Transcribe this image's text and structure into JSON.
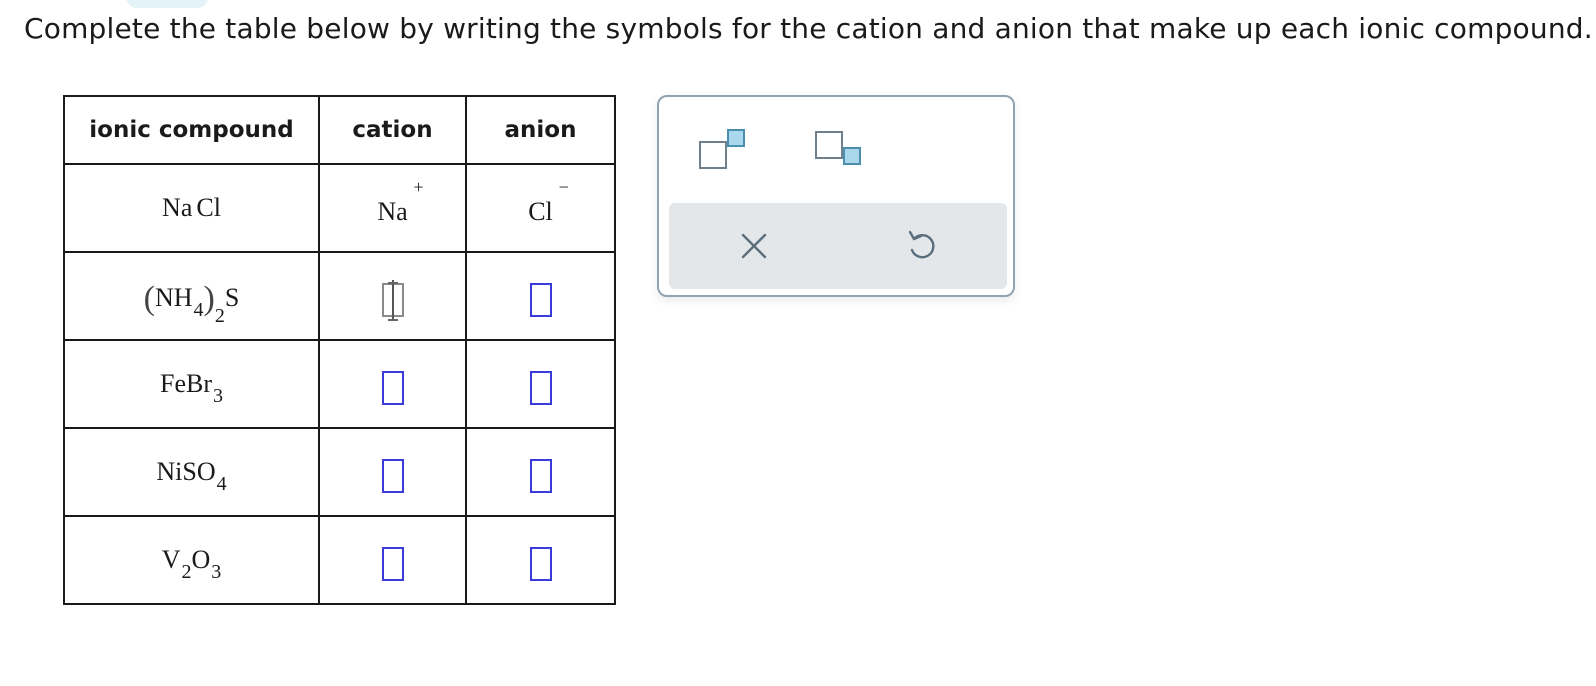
{
  "instructions": "Complete the table below by writing the symbols for the cation and anion that make up each ionic compound. T",
  "table": {
    "headers": [
      "ionic compound",
      "cation",
      "anion"
    ],
    "rows": [
      {
        "compound": {
          "parts": [
            {
              "t": "Na"
            },
            {
              "gap": true
            },
            {
              "t": "Cl"
            }
          ]
        },
        "cation": {
          "given": true,
          "symbol": "Na",
          "charge": "+"
        },
        "anion": {
          "given": true,
          "symbol": "Cl",
          "charge": "−"
        }
      },
      {
        "compound": {
          "parts": [
            {
              "paren": "("
            },
            {
              "t": "N"
            },
            {
              "t": "H"
            },
            {
              "sub": "4"
            },
            {
              "paren": ")"
            },
            {
              "subout": "2"
            },
            {
              "t": "S"
            }
          ]
        },
        "cation": {
          "given": false,
          "active": true
        },
        "anion": {
          "given": false
        }
      },
      {
        "compound": {
          "parts": [
            {
              "t": "Fe"
            },
            {
              "t": "Br"
            },
            {
              "sub": "3"
            }
          ]
        },
        "cation": {
          "given": false
        },
        "anion": {
          "given": false
        }
      },
      {
        "compound": {
          "parts": [
            {
              "t": "Ni"
            },
            {
              "t": "S"
            },
            {
              "t": "O"
            },
            {
              "sub": "4"
            }
          ]
        },
        "cation": {
          "given": false
        },
        "anion": {
          "given": false
        }
      },
      {
        "compound": {
          "parts": [
            {
              "t": "V"
            },
            {
              "sub": "2"
            },
            {
              "t": "O"
            },
            {
              "sub": "3"
            }
          ]
        },
        "cation": {
          "given": false
        },
        "anion": {
          "given": false
        }
      }
    ]
  },
  "palette": {
    "buttons": [
      "superscript",
      "subscript"
    ],
    "actions": [
      "clear",
      "undo"
    ],
    "icon_color": "#5a6e7c"
  }
}
